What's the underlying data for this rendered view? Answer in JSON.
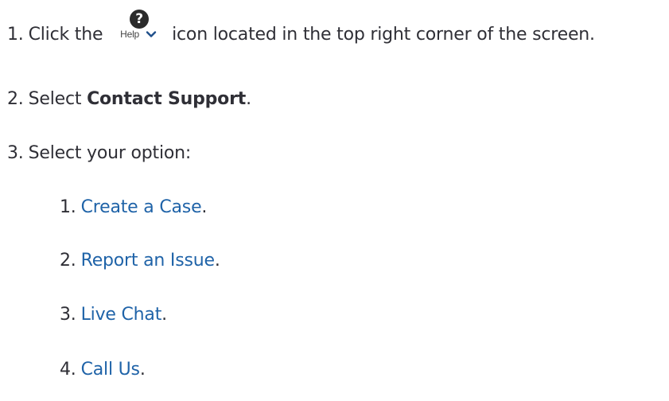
{
  "steps": [
    {
      "number": "1.",
      "text_before": "Click the",
      "help_widget": {
        "icon": "question-circle-icon",
        "glyph": "?",
        "label": "Help",
        "chevron": "chevron-down-icon"
      },
      "text_after": "icon located in the top right corner of the screen."
    },
    {
      "number": "2.",
      "text_before": "Select",
      "bold": "Contact Support",
      "text_after": "."
    },
    {
      "number": "3.",
      "text": "Select your option:"
    }
  ],
  "options": [
    {
      "number": "1.",
      "label": "Create a Case",
      "suffix": "."
    },
    {
      "number": "2.",
      "label": "Report an Issue",
      "suffix": "."
    },
    {
      "number": "3.",
      "label": "Live Chat",
      "suffix": "."
    },
    {
      "number": "4.",
      "label": "Call Us",
      "suffix": "."
    }
  ],
  "colors": {
    "text": "#2f2f36",
    "link": "#1f63a8",
    "icon": "#2b2b2b"
  }
}
